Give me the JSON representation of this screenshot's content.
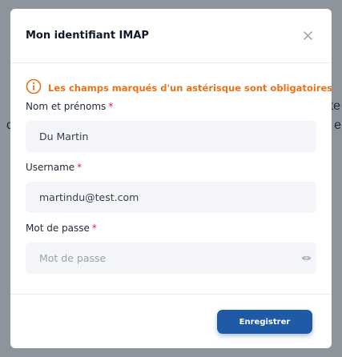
{
  "backdrop": {
    "text_left": "c",
    "text_right_top": "te",
    "text_right_bottom": "e"
  },
  "modal": {
    "title": "Mon identifiant IMAP",
    "close_icon": "close-icon",
    "notice": {
      "icon": "info-circle-icon",
      "text": "Les champs marqués d'un astérisque sont obligatoires",
      "color": "#e8731a"
    },
    "fields": [
      {
        "label": "Nom et prénoms",
        "required_mark": "*",
        "value": "Du Martin",
        "placeholder": ""
      },
      {
        "label": "Username",
        "required_mark": "*",
        "value": "martindu@test.com",
        "placeholder": ""
      },
      {
        "label": "Mot de passe",
        "required_mark": "*",
        "value": "",
        "placeholder": "Mot de passe",
        "icon": "eye-icon"
      }
    ],
    "save_label": "Enregistrer",
    "accent": "#1f5aa6"
  }
}
